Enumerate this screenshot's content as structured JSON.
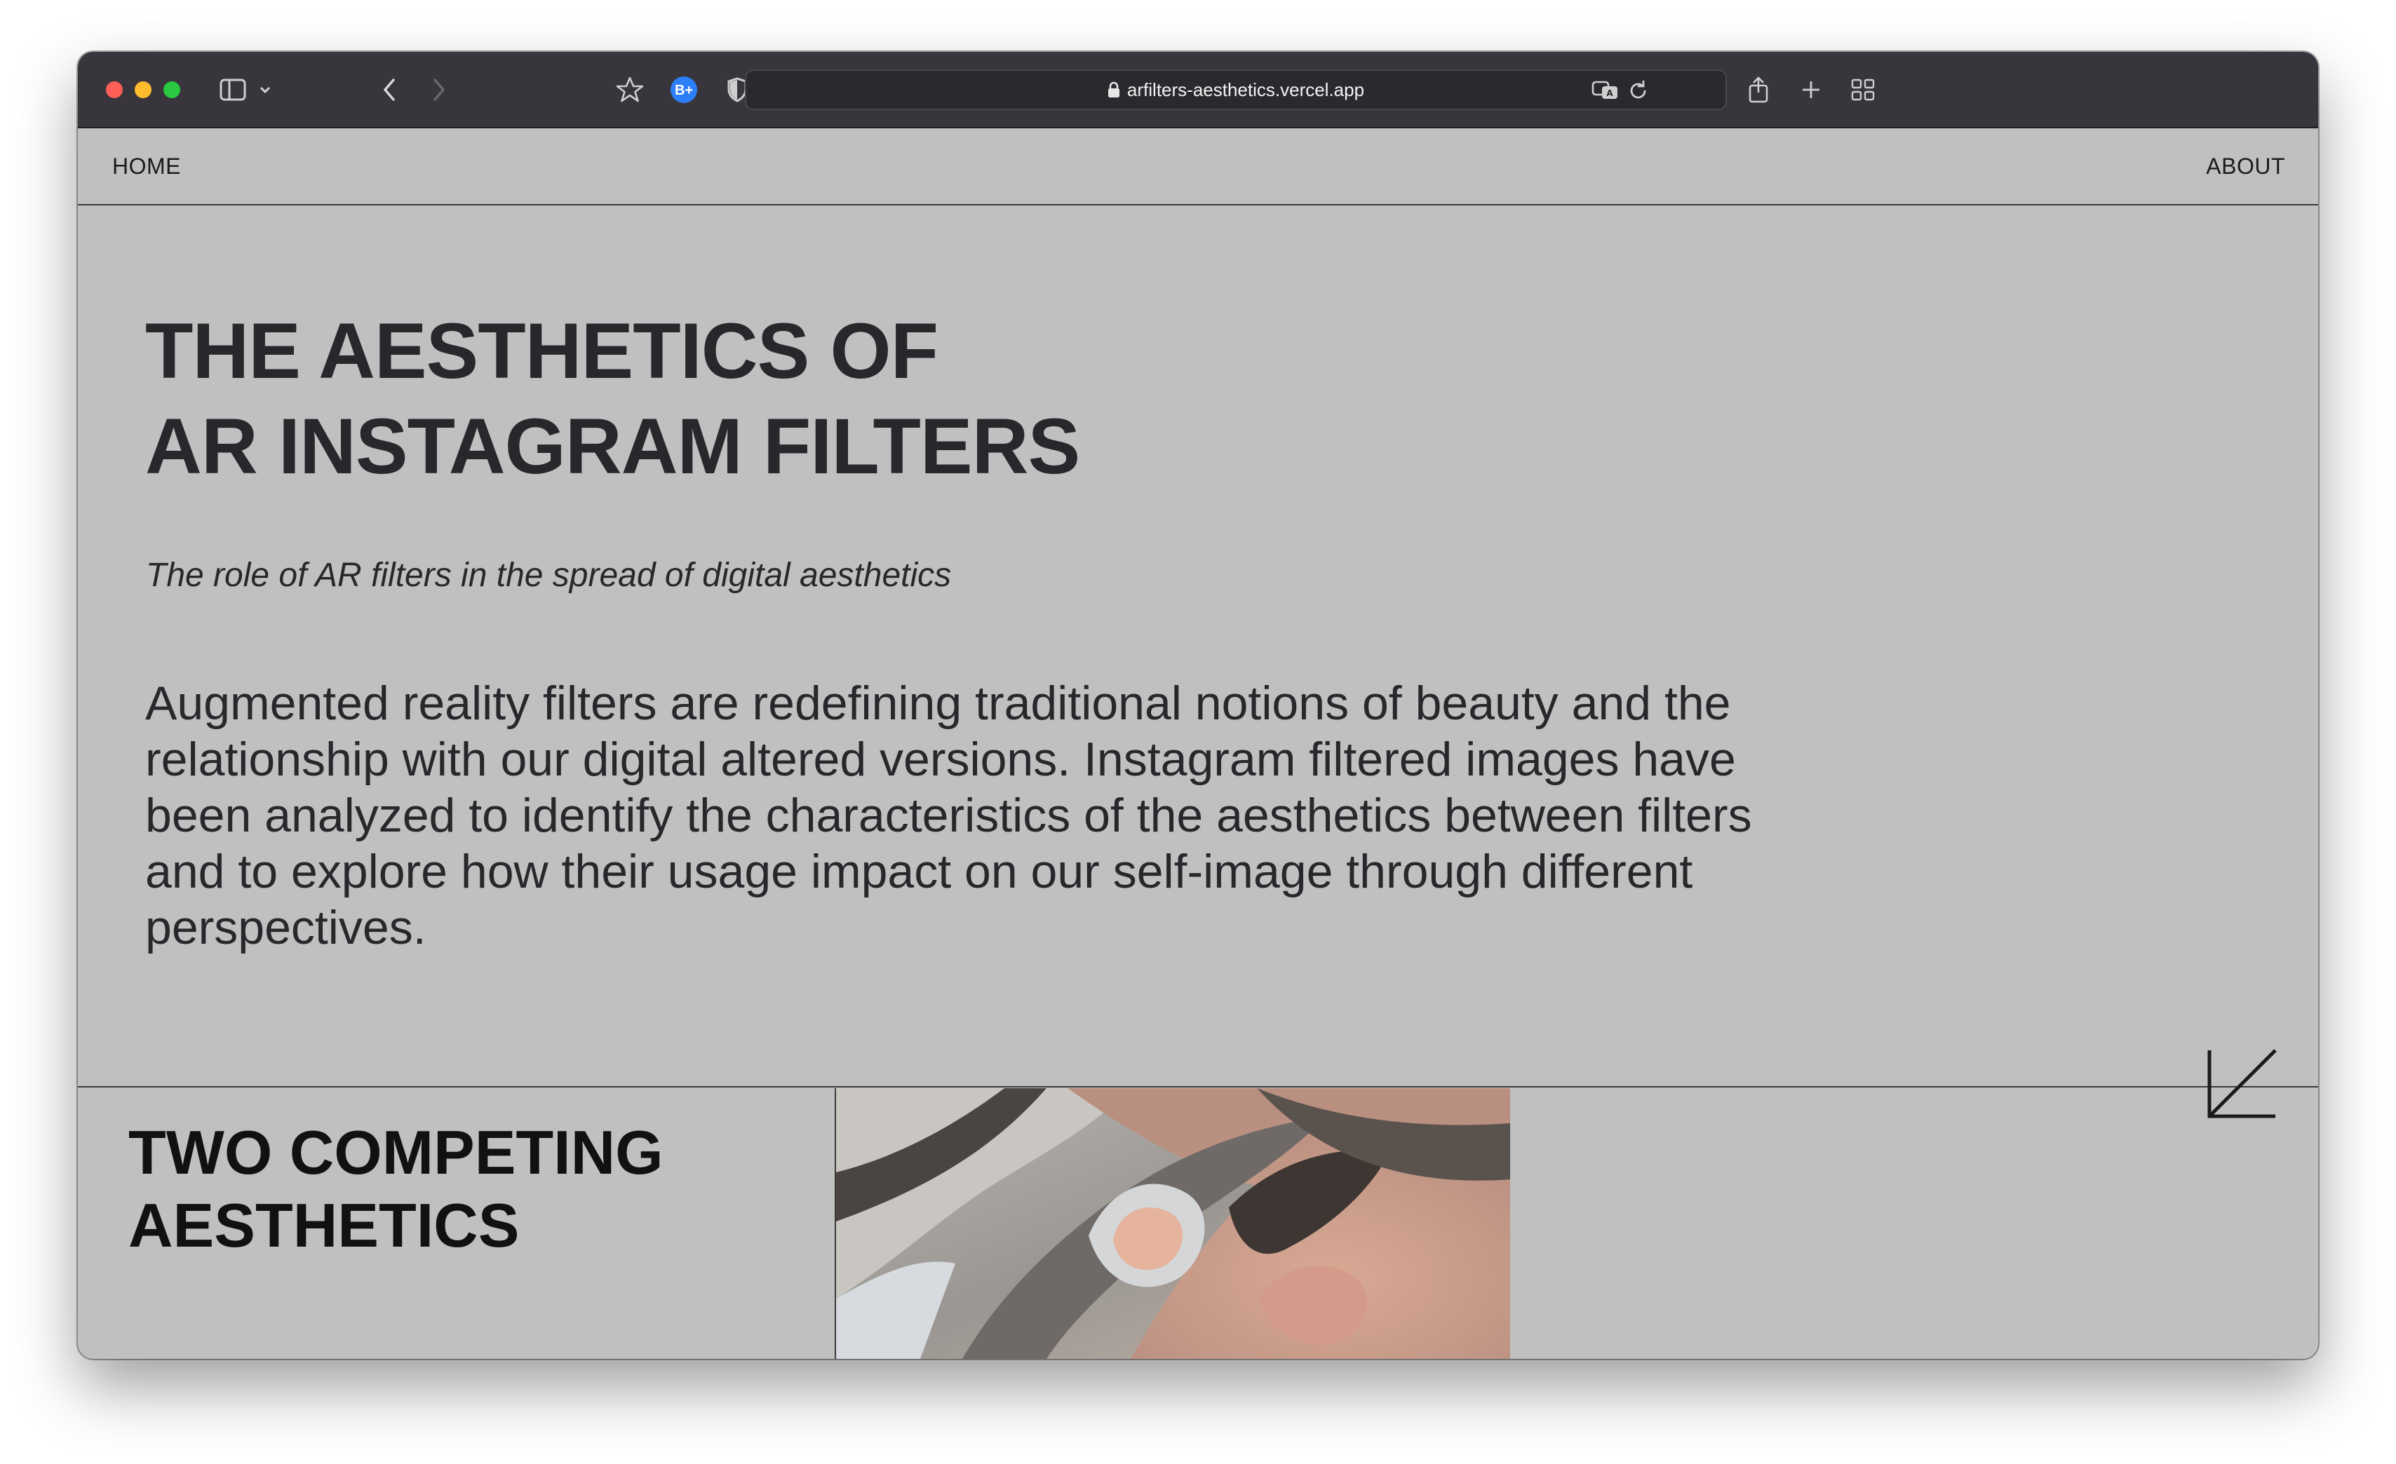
{
  "browser": {
    "url": "arfilters-aesthetics.vercel.app",
    "extension_label": "B+"
  },
  "nav": {
    "home_label": "HOME",
    "about_label": "ABOUT"
  },
  "hero": {
    "title_line1": "THE AESTHETICS OF",
    "title_line2": "AR INSTAGRAM FILTERS",
    "subtitle": "The role of AR filters in the spread of digital aesthetics",
    "body": "Augmented reality filters are redefining traditional notions of beauty and the relationship with our digital altered versions. Instagram filtered images have been analyzed to identify the characteristics of the aesthetics between filters and to explore how their usage impact on our self-image through different perspectives."
  },
  "section": {
    "title_line1": "TWO COMPETING",
    "title_line2": "AESTHETICS"
  },
  "icons": {
    "toolbar": [
      "sidebar-icon",
      "chevron-down-icon",
      "back-arrow-icon",
      "forward-arrow-icon",
      "star-icon",
      "extension-b-plus-icon",
      "shield-icon",
      "extension-blue-icon",
      "lock-icon",
      "translate-icon",
      "reload-icon",
      "share-icon",
      "new-tab-plus-icon",
      "tab-overview-icon"
    ],
    "page": [
      "arrow-down-left-icon"
    ]
  },
  "colors": {
    "toolbar_bg": "#38353c",
    "page_bg": "#c0c0c0",
    "text": "#26282b",
    "traffic_red": "#fe5f57",
    "traffic_yellow": "#febc2e",
    "traffic_green": "#28c840",
    "extension_blue": "#2d7ff9"
  }
}
